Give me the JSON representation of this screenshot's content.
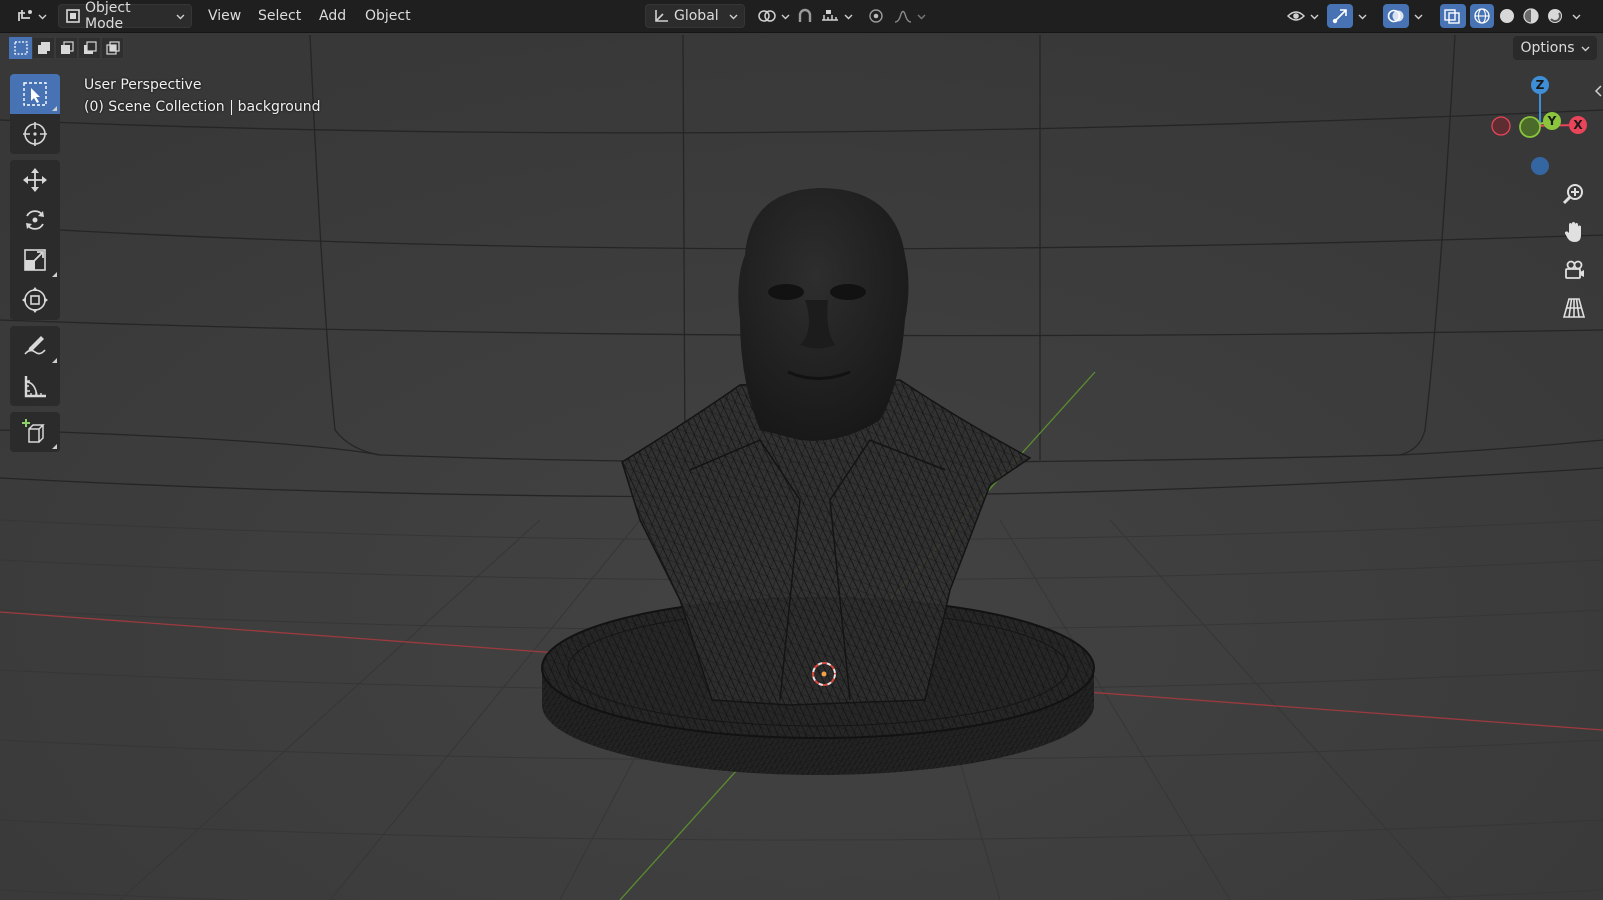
{
  "header": {
    "mode_label": "Object Mode",
    "menus": [
      "View",
      "Select",
      "Add",
      "Object"
    ],
    "orientation_label": "Global",
    "icons": [
      "editor-type-icon",
      "object-mode-icon",
      "transform-orientation-icon",
      "pivot-point-icon",
      "snap-icon",
      "snap-increment-icon",
      "proportional-edit-icon",
      "falloff-icon",
      "visibility-icon",
      "gizmo-icon",
      "overlay-icon",
      "xray-icon",
      "wireframe-shading-icon",
      "solid-shading-icon",
      "material-shading-icon",
      "rendered-shading-icon"
    ]
  },
  "options_label": "Options",
  "toolbar": {
    "tools": [
      "select-box",
      "cursor",
      "move",
      "rotate",
      "scale",
      "transform",
      "annotate",
      "measure",
      "add-cube"
    ],
    "active_tool": "select-box"
  },
  "viewport": {
    "view_name": "User Perspective",
    "collection": "(0) Scene Collection",
    "object_name": "background"
  },
  "gizmo": {
    "z_label": "Z",
    "y_label": "Y",
    "x_label": "X",
    "colors": {
      "x": "#e8445a",
      "y": "#8bc43d",
      "z": "#3f8ed8"
    }
  },
  "nav_icons": [
    "zoom-icon",
    "hand-pan-icon",
    "camera-view-icon",
    "perspective-toggle-icon"
  ],
  "colors": {
    "accent": "#4772b3",
    "header": "#1f1f1f",
    "viewport": "#3d3d3d"
  }
}
